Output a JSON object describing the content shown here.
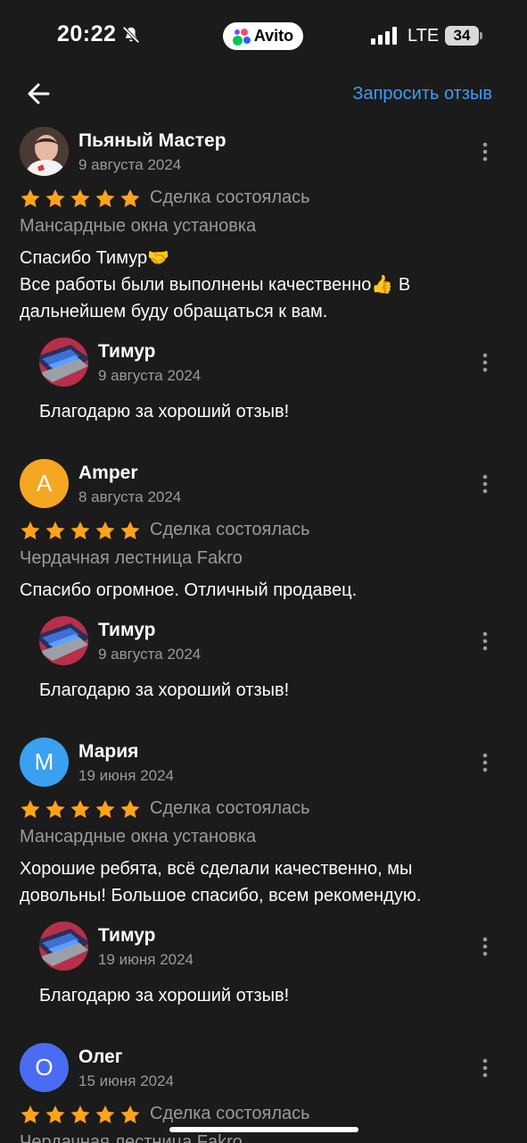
{
  "status_bar": {
    "time": "20:22",
    "brand": "Avito",
    "network": "LTE",
    "battery": "34"
  },
  "header": {
    "request_review": "Запросить отзыв"
  },
  "reviews": [
    {
      "author": "Пьяный Мастер",
      "date": "9 августа 2024",
      "rating": 5,
      "deal_status": "Сделка состоялась",
      "item": "Мансардные окна установка",
      "text_line1": "Спасибо Тимур🤝",
      "text_line2": "Все работы были выполнены качественно👍 В",
      "text_line3": "дальнейшем буду обращаться к вам.",
      "reply": {
        "author": "Тимур",
        "date": "9 августа 2024",
        "text": "Благодарю за хороший отзыв!"
      }
    },
    {
      "author": "Amper",
      "initial": "A",
      "avatar_color": "#f5a623",
      "date": "8 августа 2024",
      "rating": 5,
      "deal_status": "Сделка состоялась",
      "item": "Чердачная лестница Fakro",
      "text_line1": "Спасибо огромное. Отличный продавец.",
      "reply": {
        "author": "Тимур",
        "date": "9 августа 2024",
        "text": "Благодарю за хороший отзыв!"
      }
    },
    {
      "author": "Мария",
      "initial": "М",
      "avatar_color": "#3aa0f0",
      "date": "19 июня 2024",
      "rating": 5,
      "deal_status": "Сделка состоялась",
      "item": "Мансардные окна установка",
      "text_line1": "Хорошие ребята, всё сделали качественно, мы",
      "text_line2": "довольны! Большое спасибо, всем рекомендую.",
      "reply": {
        "author": "Тимур",
        "date": "19 июня 2024",
        "text": "Благодарю за хороший отзыв!"
      }
    },
    {
      "author": "Олег",
      "initial": "О",
      "avatar_color": "#4a6cf0",
      "date": "15 июня 2024",
      "rating": 5,
      "deal_status": "Сделка состоялась",
      "item": "Чердачная лестница Fakro"
    }
  ],
  "colors": {
    "background": "#1b1b1b",
    "accent": "#3d9bf4",
    "star": "#ffa31a",
    "muted": "#9a9a9a"
  }
}
